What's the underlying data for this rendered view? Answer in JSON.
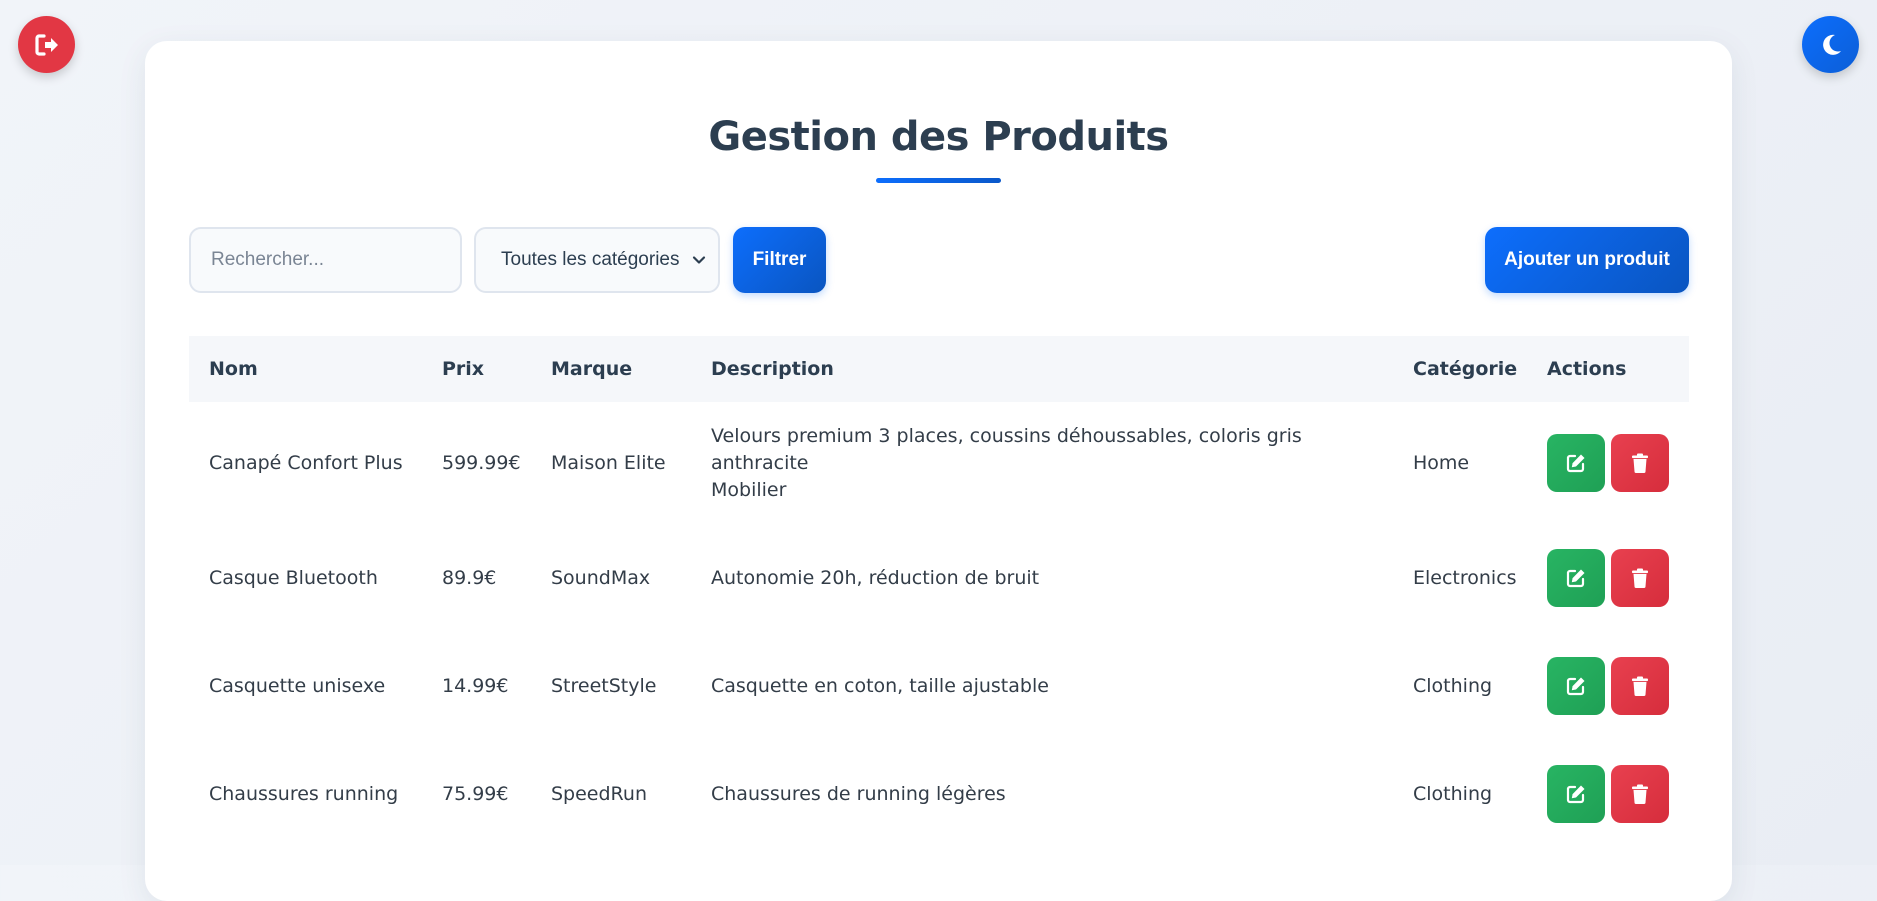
{
  "header": {
    "title": "Gestion des Produits",
    "logout_icon": "logout-icon",
    "theme_icon": "moon-icon"
  },
  "toolbar": {
    "search_placeholder": "Rechercher...",
    "category_selected": "Toutes les catégories",
    "filter_label": "Filtrer",
    "add_label": "Ajouter un produit"
  },
  "table": {
    "headers": {
      "nom": "Nom",
      "prix": "Prix",
      "marque": "Marque",
      "description": "Description",
      "categorie": "Catégorie",
      "actions": "Actions"
    },
    "rows": [
      {
        "nom": "Canapé Confort Plus",
        "prix": "599.99€",
        "marque": "Maison Elite",
        "description": "Velours premium 3 places, coussins déhoussables, coloris gris anthracite",
        "description2": "Mobilier",
        "categorie": "Home"
      },
      {
        "nom": "Casque Bluetooth",
        "prix": "89.9€",
        "marque": "SoundMax",
        "description": "Autonomie 20h, réduction de bruit",
        "categorie": "Electronics"
      },
      {
        "nom": "Casquette unisexe",
        "prix": "14.99€",
        "marque": "StreetStyle",
        "description": "Casquette en coton, taille ajustable",
        "categorie": "Clothing"
      },
      {
        "nom": "Chaussures running",
        "prix": "75.99€",
        "marque": "SpeedRun",
        "description": "Chaussures de running légères",
        "categorie": "Clothing"
      }
    ]
  },
  "colors": {
    "primary": "#0d6efd",
    "danger": "#e23744",
    "success": "#28b463"
  }
}
